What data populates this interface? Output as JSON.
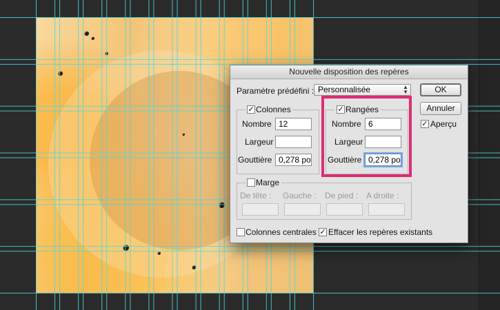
{
  "dialog": {
    "title": "Nouvelle disposition des repères",
    "preset_label": "Paramètre prédéfini :",
    "preset_value": "Personnalisée",
    "ok_label": "OK",
    "cancel_label": "Annuler",
    "preview_label": "Aperçu",
    "columns": {
      "label": "Colonnes",
      "checked": true,
      "number_label": "Nombre",
      "number_value": "12",
      "width_label": "Largeur",
      "width_value": "",
      "gutter_label": "Gouttière",
      "gutter_value": "0,278 po"
    },
    "rows": {
      "label": "Rangées",
      "checked": true,
      "number_label": "Nombre",
      "number_value": "6",
      "height_label": "Largeur",
      "height_value": "",
      "gutter_label": "Gouttière",
      "gutter_value": "0,278 po"
    },
    "margin": {
      "label": "Marge",
      "checked": false,
      "top_label": "De tête :",
      "left_label": "Gauche :",
      "bottom_label": "De pied :",
      "right_label": "A droite :"
    },
    "center_columns_label": "Colonnes centrales",
    "clear_guides_label": "Effacer les repères existants"
  },
  "colors": {
    "guide": "#4ed8df",
    "highlight": "#dc2c74",
    "workspace": "#2b2b2b"
  }
}
